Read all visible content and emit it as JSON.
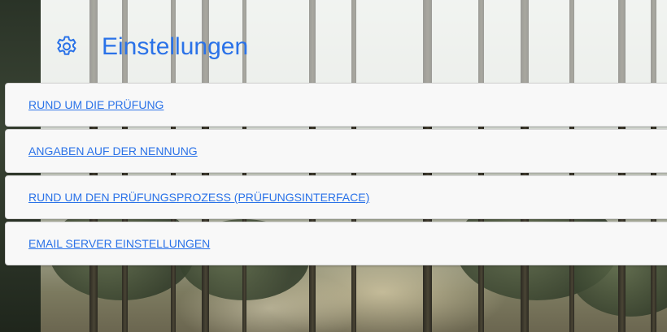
{
  "header": {
    "title": "Einstellungen",
    "icon": "gear-icon"
  },
  "menu": {
    "items": [
      {
        "label": "RUND UM DIE PRÜFUNG"
      },
      {
        "label": "ANGABEN AUF DER NENNUNG"
      },
      {
        "label": "RUND UM DEN PRÜFUNGSPROZESS (PRÜFUNGSINTERFACE)"
      },
      {
        "label": "EMAIL SERVER EINSTELLUNGEN"
      }
    ]
  },
  "colors": {
    "accent": "#2a72e8",
    "item_background": "#f8f8f8"
  }
}
